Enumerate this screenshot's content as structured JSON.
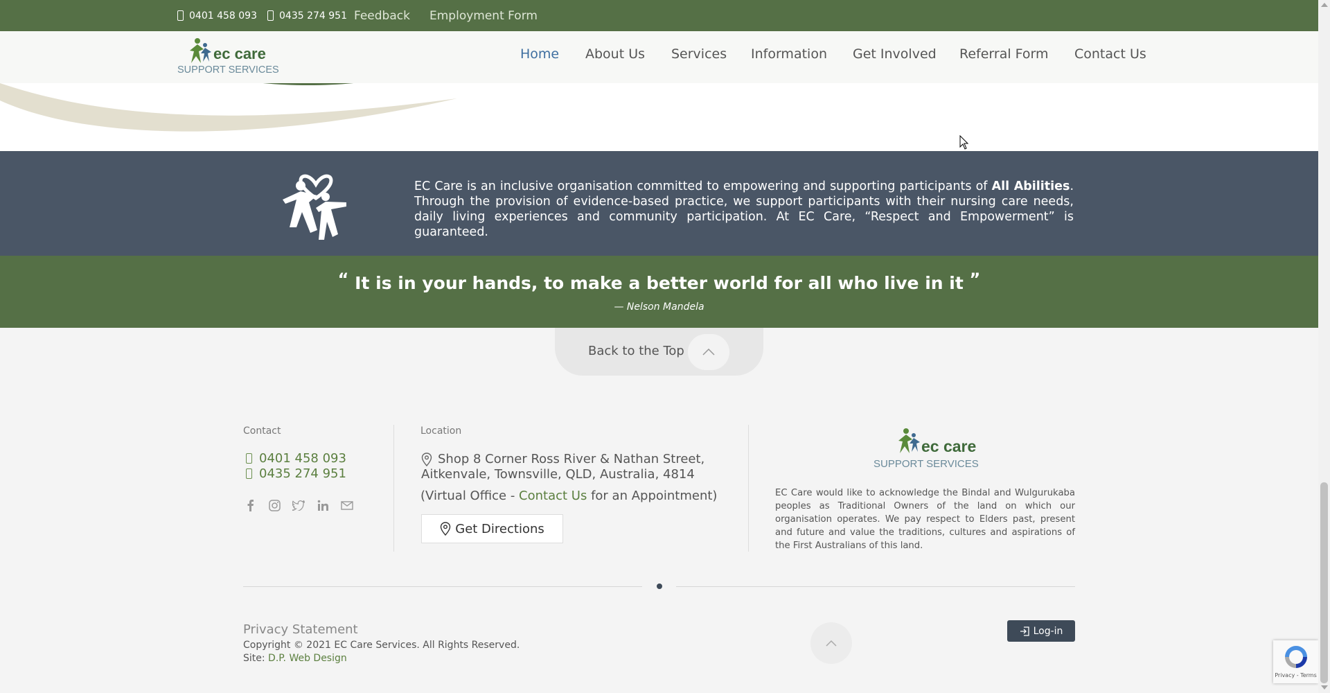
{
  "topbar": {
    "phone1": "0401 458 093",
    "phone2": "0435 274 951",
    "feedback": "Feedback",
    "employment": "Employment Form"
  },
  "brand": {
    "name": "ec care",
    "tagline": "SUPPORT SERVICES"
  },
  "nav": {
    "home": "Home",
    "about": "About Us",
    "services": "Services",
    "information": "Information",
    "get_involved": "Get Involved",
    "referral": "Referral Form",
    "contact": "Contact Us"
  },
  "mission": {
    "text_before": "EC Care is an inclusive organisation committed to empowering and supporting participants of ",
    "bold": "All Abilities",
    "text_after": ". Through the provision of evidence-based practice, we support participants with their nursing care needs, daily living experiences and community participation. At EC Care, “Respect and Empowerment” is guaranteed."
  },
  "quote": {
    "open_mark": "“",
    "text": "It is in your hands, to make a better world for all who live in it",
    "close_mark": "”",
    "author": "— Nelson Mandela"
  },
  "back_to_top": "Back to the Top",
  "footer": {
    "contact_heading": "Contact",
    "phone1": "0401 458 093",
    "phone2": "0435 274 951",
    "location_heading": "Location",
    "address_line1": "Shop 8 Corner Ross River & Nathan Street,",
    "address_line2": "Aitkenvale, Townsville, QLD, Australia, 4814",
    "virtual_before": "(Virtual Office - ",
    "virtual_link": "Contact Us",
    "virtual_after": " for an Appointment)",
    "directions": "Get Directions",
    "acknowledgement": "EC Care would like to acknowledge the Bindal and Wulgurukaba peoples as Traditional Owners of the land on which our organisation operates. We pay respect to Elders past, present and future and value the traditions, cultures and aspirations of the First Australians of this land.",
    "privacy": "Privacy Statement",
    "copyright": "Copyright © 2021 EC Care Services. All Rights Reserved.",
    "site_label": "Site: ",
    "site_link": "D.P. Web Design",
    "login": "Log-in"
  },
  "recaptcha": {
    "links": "Privacy - Terms"
  },
  "colors": {
    "green": "#557046",
    "slate": "#4a5666",
    "accent_link": "#5b7f3f",
    "nav_active": "#3f6fa0"
  },
  "icons": [
    "phone-icon",
    "facebook-icon",
    "instagram-icon",
    "twitter-icon",
    "linkedin-icon",
    "mail-icon",
    "map-pin-icon",
    "chevron-up-icon",
    "login-icon",
    "people-heart-icon",
    "recaptcha-icon"
  ]
}
